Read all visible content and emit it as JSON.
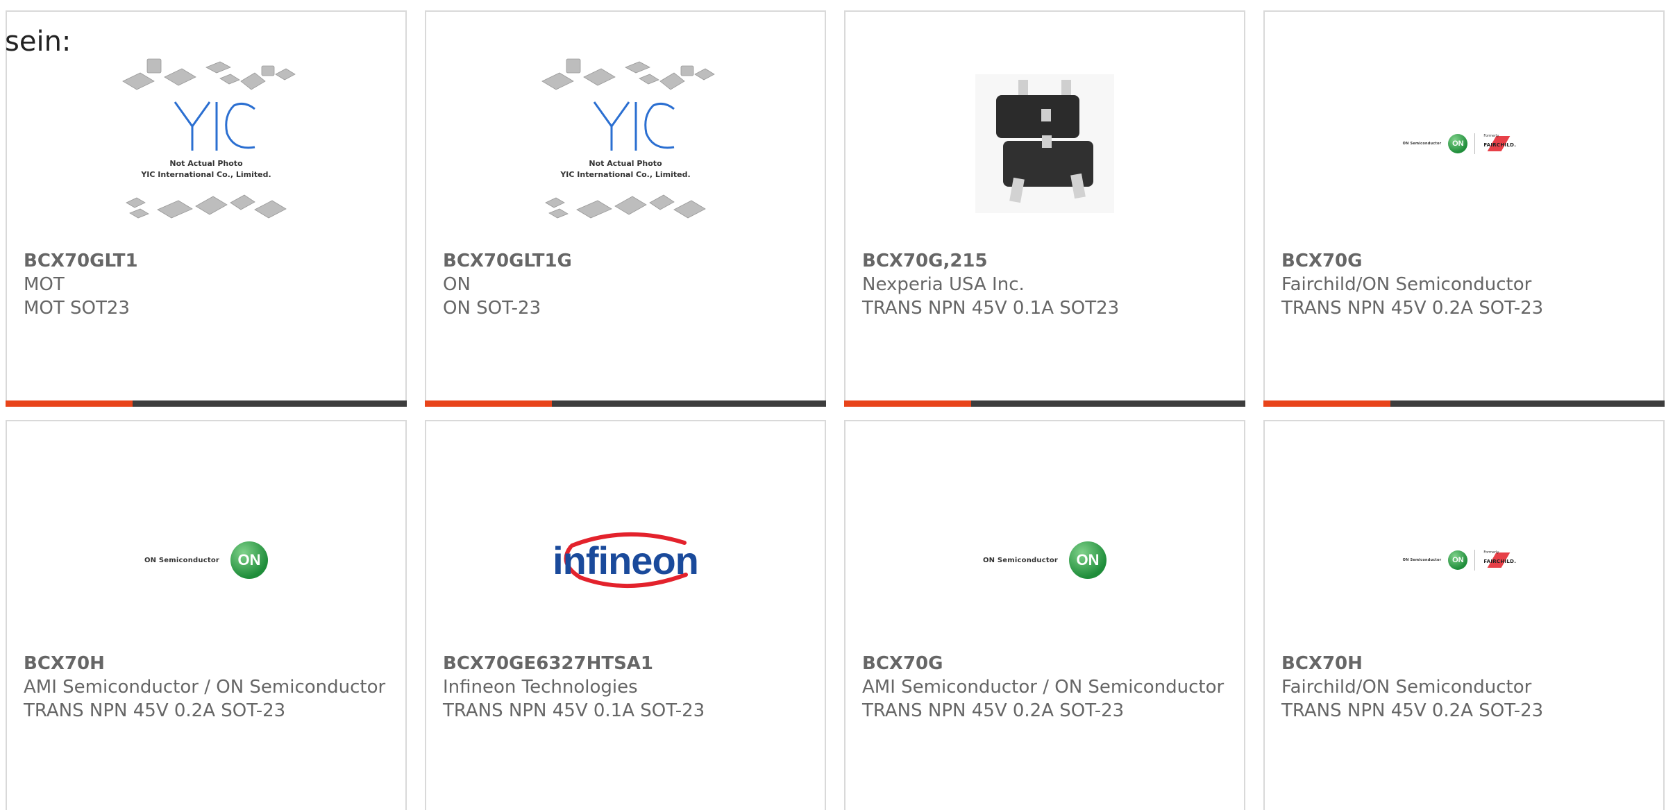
{
  "intro_text": "sein:",
  "colors": {
    "accent": "#e8441a",
    "bar_dark": "#3d3d3d",
    "text": "#666666",
    "on_green": "#1f8d3a",
    "infineon_red": "#e3222c",
    "infineon_blue": "#1a4a9b"
  },
  "yic_caption": {
    "line1": "Not Actual Photo",
    "line2": "YIC International Co., Limited."
  },
  "logos": {
    "on_semiconductor": "ON Semiconductor",
    "on_mark": "ON",
    "formerly": "Formerly",
    "fairchild": "FAIRCHILD.",
    "infineon": "infineon"
  },
  "products": [
    {
      "part": "BCX70GLT1",
      "manufacturer": "MOT",
      "description": "MOT SOT23",
      "image": "yic-placeholder"
    },
    {
      "part": "BCX70GLT1G",
      "manufacturer": "ON",
      "description": "ON SOT-23",
      "image": "yic-placeholder"
    },
    {
      "part": "BCX70G,215",
      "manufacturer": "Nexperia USA Inc.",
      "description": "TRANS NPN 45V 0.1A SOT23",
      "image": "sot23-chip-photo"
    },
    {
      "part": "BCX70G",
      "manufacturer": "Fairchild/ON Semiconductor",
      "description": "TRANS NPN 45V 0.2A SOT-23",
      "image": "on-fairchild-logo"
    },
    {
      "part": "BCX70H",
      "manufacturer": "AMI Semiconductor / ON Semiconductor",
      "description": "TRANS NPN 45V 0.2A SOT-23",
      "image": "on-semiconductor-logo"
    },
    {
      "part": "BCX70GE6327HTSA1",
      "manufacturer": "Infineon Technologies",
      "description": "TRANS NPN 45V 0.1A SOT-23",
      "image": "infineon-logo"
    },
    {
      "part": "BCX70G",
      "manufacturer": "AMI Semiconductor / ON Semiconductor",
      "description": "TRANS NPN 45V 0.2A SOT-23",
      "image": "on-semiconductor-logo"
    },
    {
      "part": "BCX70H",
      "manufacturer": "Fairchild/ON Semiconductor",
      "description": "TRANS NPN 45V 0.2A SOT-23",
      "image": "on-fairchild-logo"
    }
  ]
}
